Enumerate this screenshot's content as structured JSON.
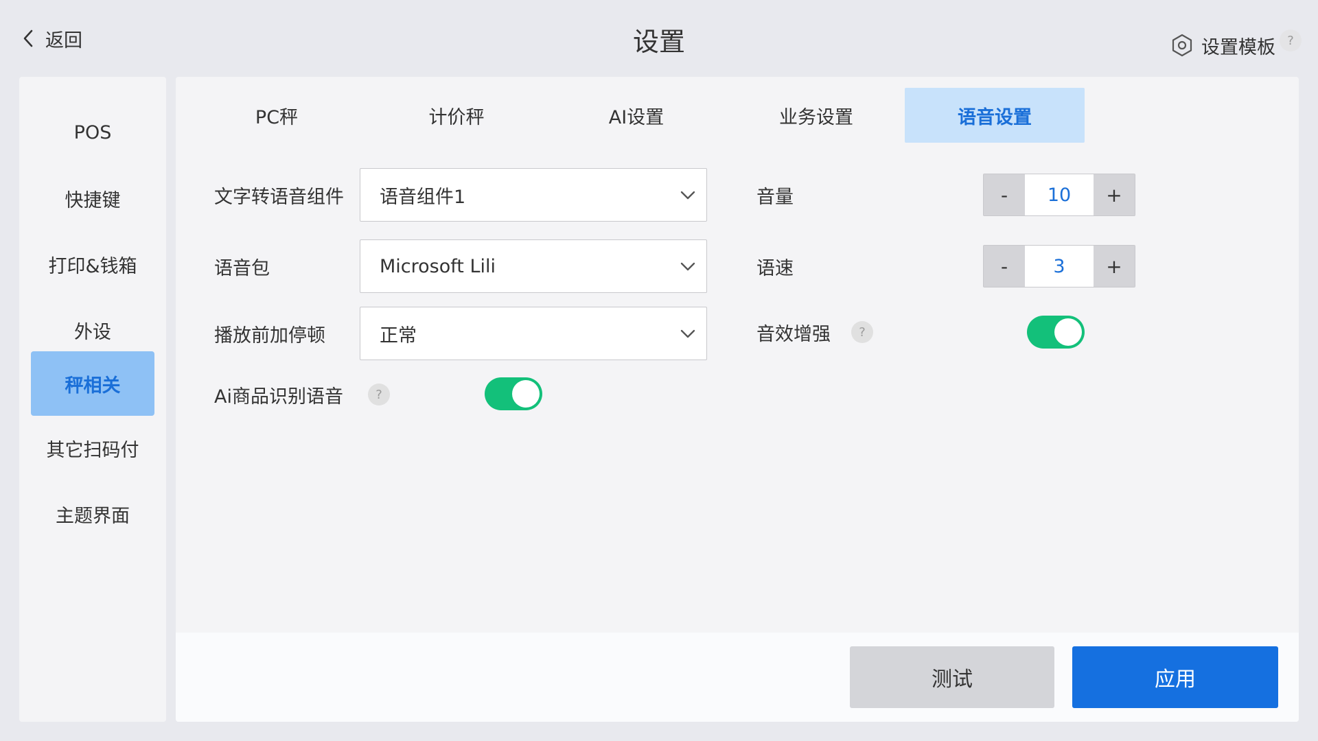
{
  "header": {
    "back_label": "返回",
    "title": "设置",
    "template_label": "设置模板",
    "help": "?"
  },
  "sidebar": {
    "items": [
      {
        "label": "POS",
        "active": false
      },
      {
        "label": "快捷键",
        "active": false
      },
      {
        "label": "打印&钱箱",
        "active": false
      },
      {
        "label": "外设",
        "active": false
      },
      {
        "label": "秤相关",
        "active": true
      },
      {
        "label": "其它扫码付",
        "active": false
      },
      {
        "label": "主题界面",
        "active": false
      }
    ]
  },
  "tabs": [
    {
      "label": "PC秤",
      "active": false
    },
    {
      "label": "计价秤",
      "active": false
    },
    {
      "label": "AI设置",
      "active": false
    },
    {
      "label": "业务设置",
      "active": false
    },
    {
      "label": "语音设置",
      "active": true
    }
  ],
  "form": {
    "tts": {
      "label": "文字转语音组件",
      "value": "语音组件1"
    },
    "voice_pack": {
      "label": "语音包",
      "value": "Microsoft Lili"
    },
    "pause": {
      "label": "播放前加停顿",
      "value": "正常"
    },
    "ai_voice": {
      "label": "Ai商品识别语音",
      "help": "?",
      "enabled": true
    },
    "volume": {
      "label": "音量",
      "value": "10",
      "minus": "-",
      "plus": "+"
    },
    "speed": {
      "label": "语速",
      "value": "3",
      "minus": "-",
      "plus": "+"
    },
    "enhance": {
      "label": "音效增强",
      "help": "?",
      "enabled": true
    }
  },
  "footer": {
    "test_label": "测试",
    "apply_label": "应用"
  },
  "colors": {
    "accent": "#1570e0",
    "toggle_on": "#13c07a",
    "active_tab_bg": "#c8e2fb",
    "active_side_bg": "#8ec1f5"
  }
}
